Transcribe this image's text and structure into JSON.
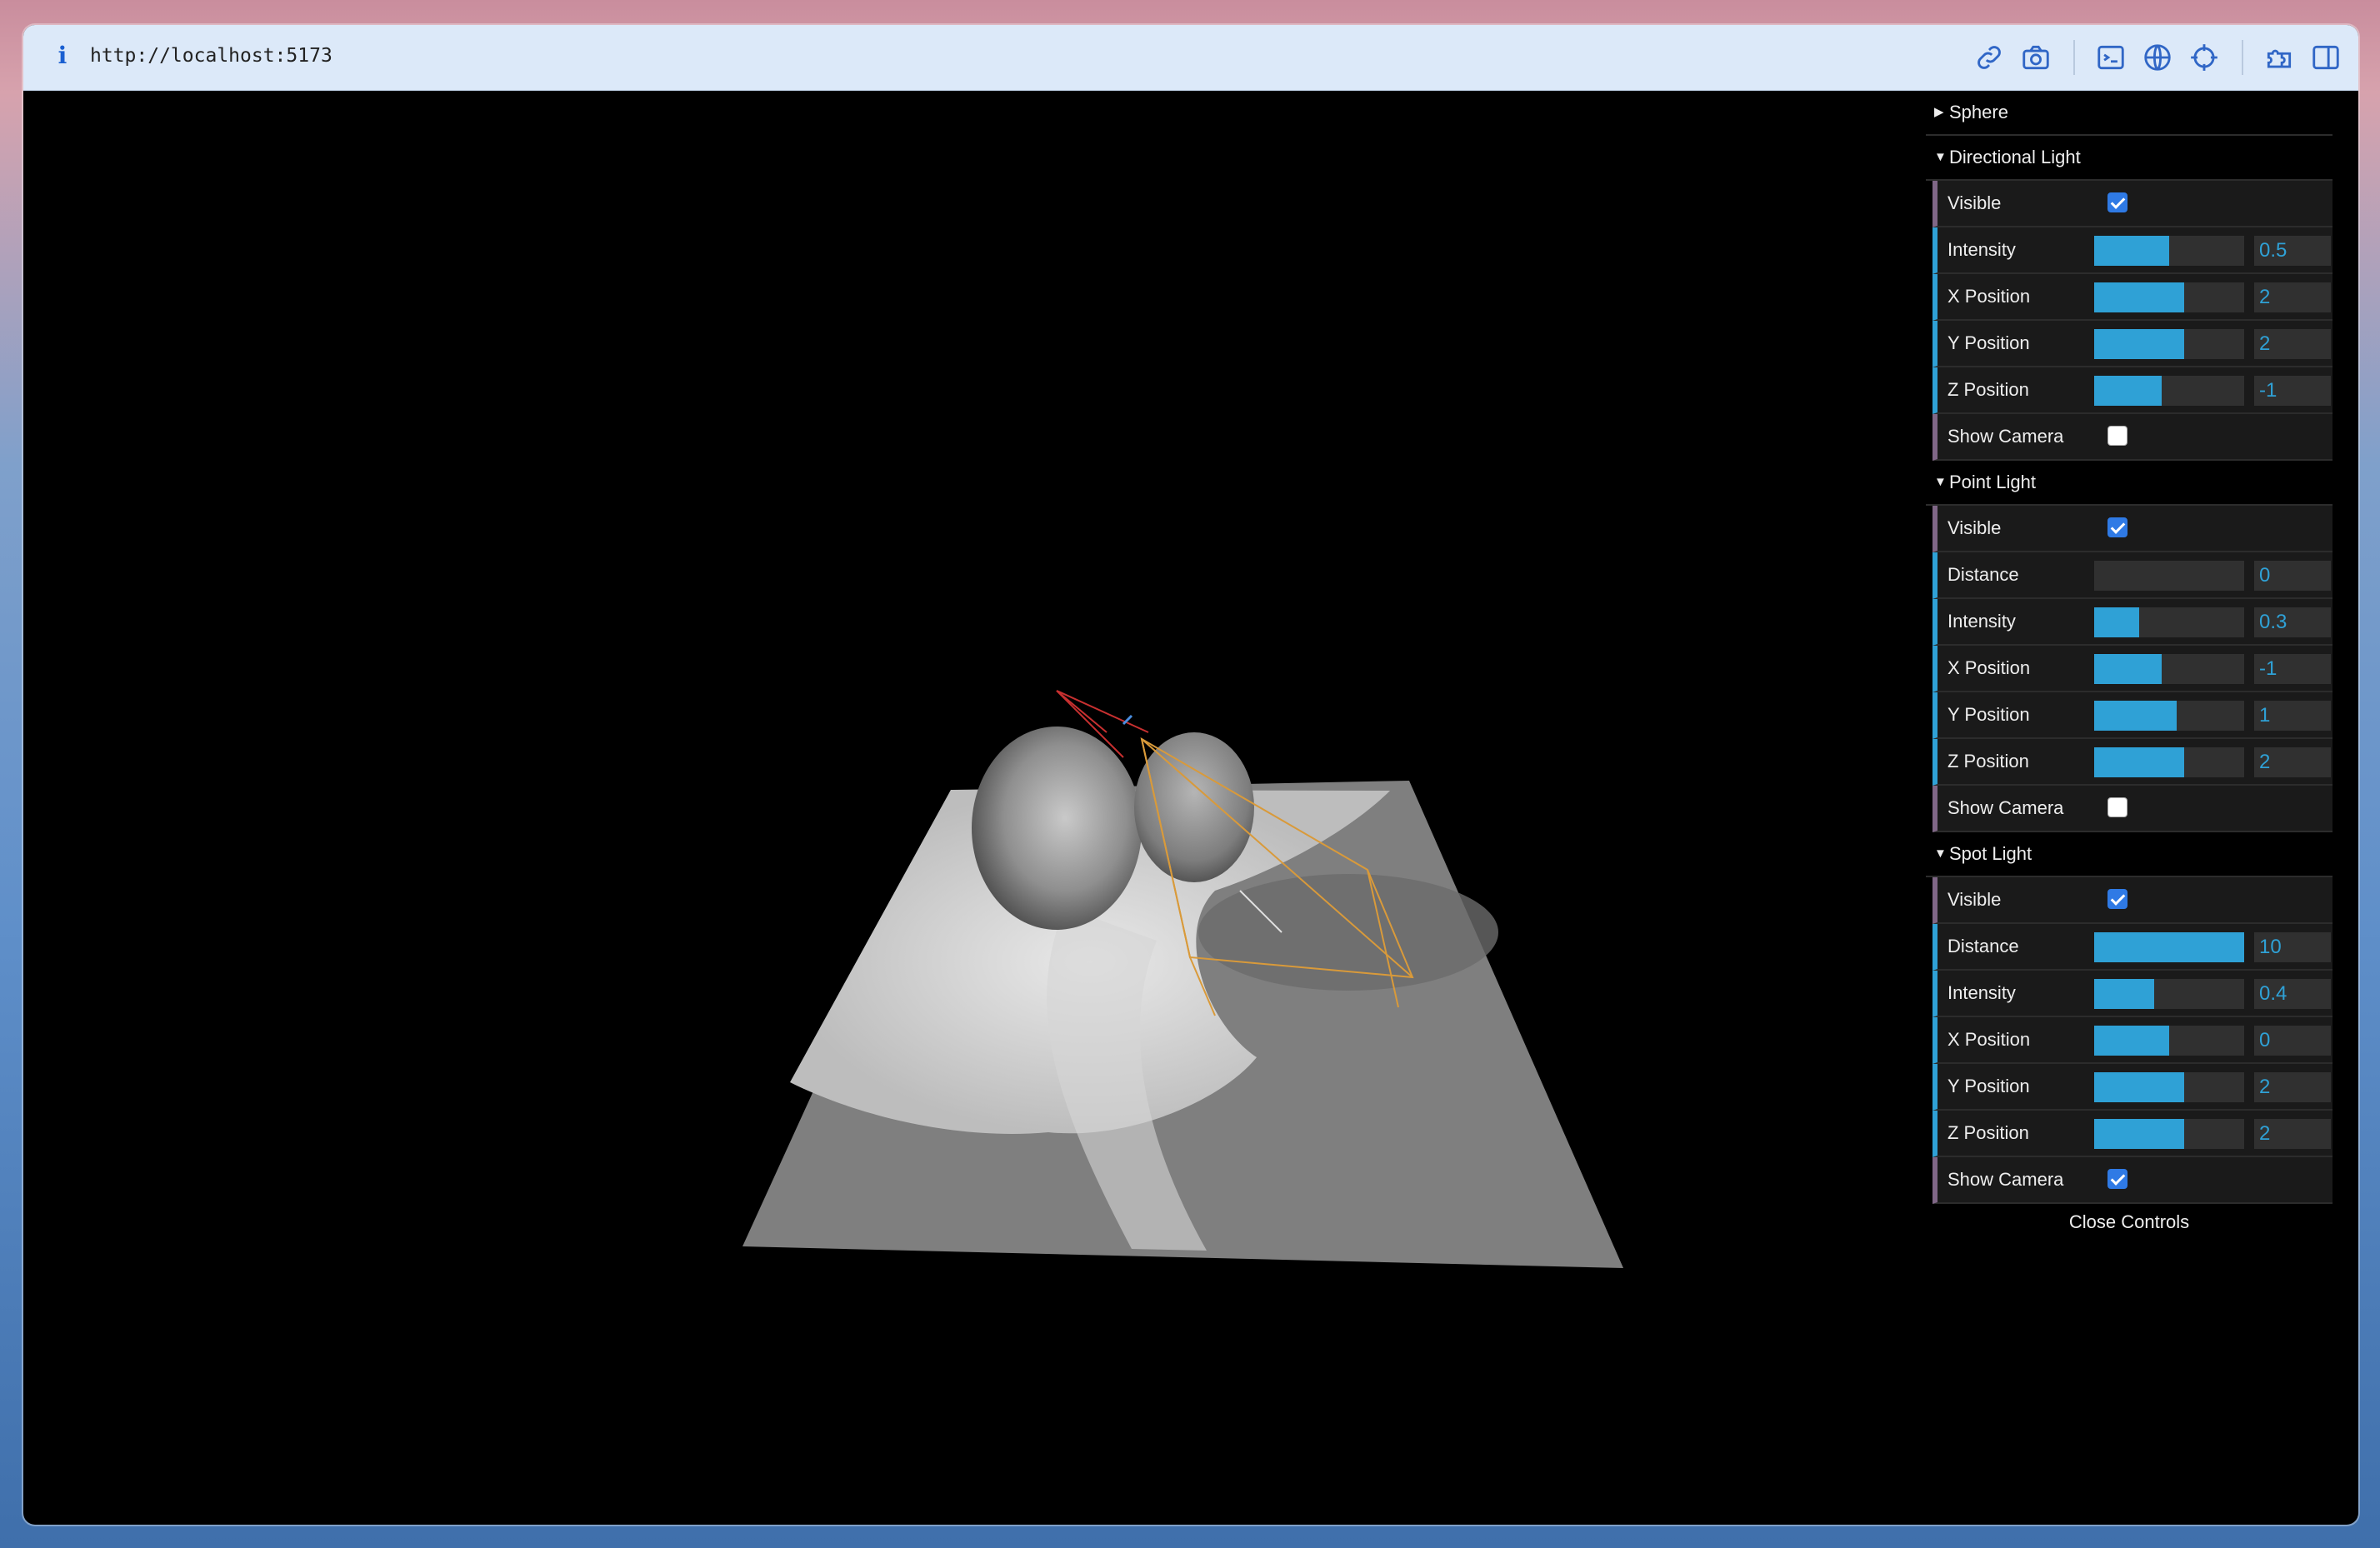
{
  "browser": {
    "url": "http://localhost:5173",
    "icons": [
      "info-icon",
      "link-icon",
      "camera-icon",
      "terminal-icon",
      "globe-icon",
      "crosshair-icon",
      "extension-icon",
      "sidebar-icon"
    ]
  },
  "scene": {
    "description_colors": {
      "background": "#000000",
      "plane": "#8a8a8a",
      "sphere": "#9a9a9a"
    }
  },
  "gui": {
    "accent": "#2fa1d6",
    "folders": [
      {
        "title": "Sphere",
        "open": false,
        "controls": []
      },
      {
        "title": "Directional Light",
        "open": true,
        "controls": [
          {
            "label": "Visible",
            "type": "boolean",
            "checked": true
          },
          {
            "label": "Intensity",
            "type": "number",
            "value": "0.5",
            "fill": 0.5
          },
          {
            "label": "X Position",
            "type": "number",
            "value": "2",
            "fill": 0.6
          },
          {
            "label": "Y Position",
            "type": "number",
            "value": "2",
            "fill": 0.6
          },
          {
            "label": "Z Position",
            "type": "number",
            "value": "-1",
            "fill": 0.45
          },
          {
            "label": "Show Camera",
            "type": "boolean",
            "checked": false
          }
        ]
      },
      {
        "title": "Point Light",
        "open": true,
        "controls": [
          {
            "label": "Visible",
            "type": "boolean",
            "checked": true
          },
          {
            "label": "Distance",
            "type": "number",
            "value": "0",
            "fill": 0.0
          },
          {
            "label": "Intensity",
            "type": "number",
            "value": "0.3",
            "fill": 0.3
          },
          {
            "label": "X Position",
            "type": "number",
            "value": "-1",
            "fill": 0.45
          },
          {
            "label": "Y Position",
            "type": "number",
            "value": "1",
            "fill": 0.55
          },
          {
            "label": "Z Position",
            "type": "number",
            "value": "2",
            "fill": 0.6
          },
          {
            "label": "Show Camera",
            "type": "boolean",
            "checked": false
          }
        ]
      },
      {
        "title": "Spot Light",
        "open": true,
        "controls": [
          {
            "label": "Visible",
            "type": "boolean",
            "checked": true
          },
          {
            "label": "Distance",
            "type": "number",
            "value": "10",
            "fill": 1.0
          },
          {
            "label": "Intensity",
            "type": "number",
            "value": "0.4",
            "fill": 0.4
          },
          {
            "label": "X Position",
            "type": "number",
            "value": "0",
            "fill": 0.5
          },
          {
            "label": "Y Position",
            "type": "number",
            "value": "2",
            "fill": 0.6
          },
          {
            "label": "Z Position",
            "type": "number",
            "value": "2",
            "fill": 0.6
          },
          {
            "label": "Show Camera",
            "type": "boolean",
            "checked": true
          }
        ]
      }
    ],
    "close_label": "Close Controls"
  }
}
